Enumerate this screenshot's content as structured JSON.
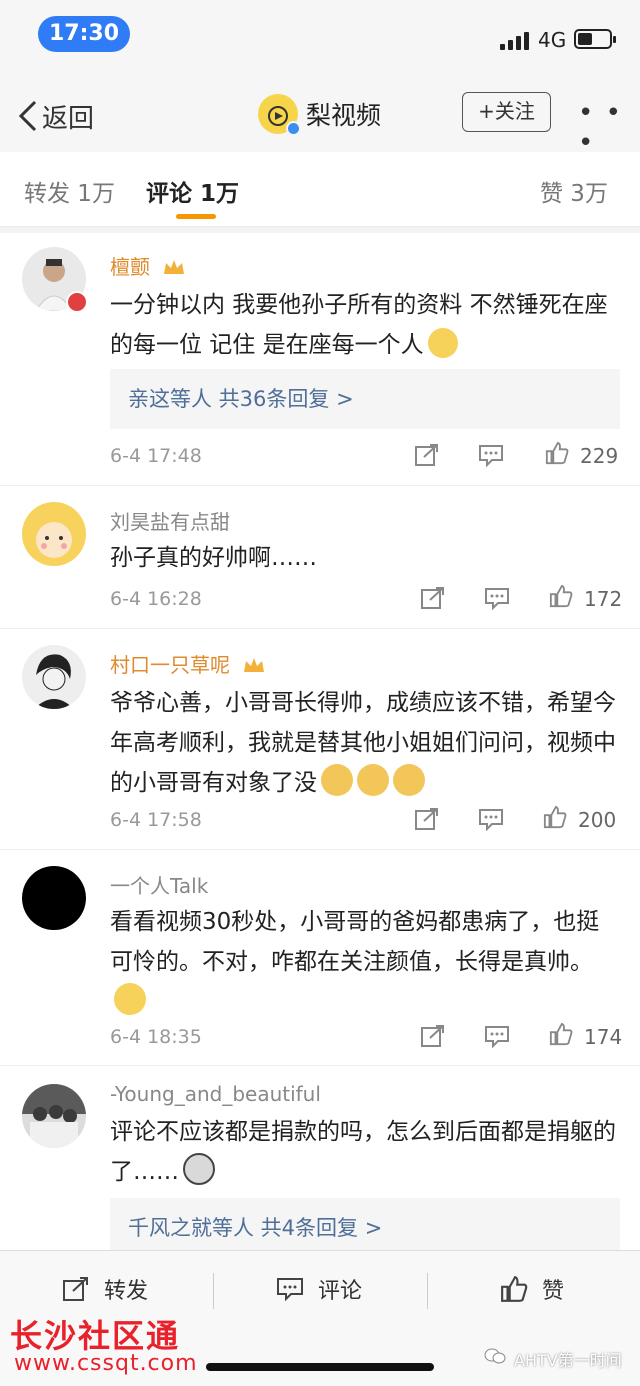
{
  "status_bar": {
    "time": "17:30",
    "network": "4G",
    "battery_level": 0.45
  },
  "nav": {
    "back_label": "返回",
    "account_name": "梨视频",
    "follow_label": "+关注",
    "more": "• • •"
  },
  "tabs": {
    "repost": "转发 1万",
    "comment": "评论 1万",
    "like": "赞 3万"
  },
  "comments": [
    {
      "user": "檀颤",
      "vip": true,
      "text": "一分钟以内 我要他孙子所有的资料 不然锤死在座的每一位 记住 是在座每一个人",
      "reply_summary": "亲这等人  共36条回复 >",
      "time": "6-4 17:48",
      "likes": "229"
    },
    {
      "user": "刘昊盐有点甜",
      "vip": false,
      "text": "孙子真的好帅啊……",
      "time": "6-4 16:28",
      "likes": "172"
    },
    {
      "user": "村口一只草呢",
      "vip": true,
      "text": "爷爷心善，小哥哥长得帅，成绩应该不错，希望今年高考顺利，我就是替其他小姐姐们问问，视频中的小哥哥有对象了没",
      "time": "6-4 17:58",
      "likes": "200"
    },
    {
      "user": "一个人Talk",
      "vip": false,
      "text": "看看视频30秒处，小哥哥的爸妈都患病了，也挺可怜的。不对，咋都在关注颜值，长得是真帅。",
      "time": "6-4 18:35",
      "likes": "174"
    },
    {
      "user": "-Young_and_beautiful",
      "vip": false,
      "text": "评论不应该都是捐款的吗，怎么到后面都是捐躯的了……",
      "reply_summary": "千风之就等人  共4条回复 >"
    }
  ],
  "bottom_bar": {
    "repost": "转发",
    "comment": "评论",
    "like": "赞"
  },
  "watermark": {
    "title": "长沙社区通",
    "url": "www.cssqt.com",
    "source": "AHTV第一时间"
  },
  "colors": {
    "accent": "#f39800",
    "link": "#4f6f98",
    "status_pill": "#2f7cf6",
    "watermark": "#e8212a"
  }
}
